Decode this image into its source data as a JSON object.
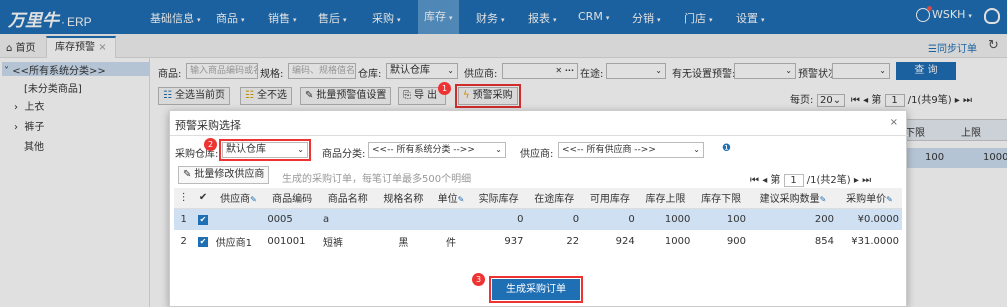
{
  "topbar": {
    "logo_text": "万里牛",
    "logo_dot": "·",
    "logo_erp": "ERP",
    "nav": [
      "基础信息",
      "商品",
      "销售",
      "售后",
      "采购",
      "库存",
      "财务",
      "报表",
      "CRM",
      "分销",
      "门店",
      "设置"
    ],
    "active_nav": "库存",
    "caret": "▾",
    "user": "WSKH",
    "user_caret": "▾",
    "accent": "#1f6fb5"
  },
  "tabs": {
    "home": "首页",
    "stock": "库存预警",
    "close": "×",
    "sync": "同步订单"
  },
  "sidebar": {
    "root": "<<所有系统分类>>",
    "items": [
      "[未分类商品]",
      "上衣",
      "裤子",
      "其他"
    ]
  },
  "filters": {
    "product_label": "商品:",
    "product_placeholder": "输入商品编码或名",
    "spec_label": "规格:",
    "spec_placeholder": "编码、规格值名称",
    "warehouse_label": "仓库:",
    "warehouse_value": "默认仓库",
    "supplier_label": "供应商:",
    "intransit_label": "在途:",
    "noupper_label": "有无设置预警:",
    "warnstatus_label": "预警状况:",
    "query": "查 询"
  },
  "toolbar": {
    "select_all": "全选当前页",
    "select_none": "全不选",
    "batch_warn": "批量预警值设置",
    "export": "导 出",
    "warn_purchase": "预警采购",
    "per_page_label": "每页:",
    "per_page": "20",
    "page_label": "第",
    "page": "1",
    "page_total": "/1(共9笔)"
  },
  "bg_grid": {
    "lower": "下限",
    "upper": "上限",
    "v1": "100",
    "v2": "1000"
  },
  "dialog": {
    "title": "预警采购选择",
    "close": "×",
    "warehouse_label": "采购仓库:",
    "warehouse_value": "默认仓库",
    "category_label": "商品分类:",
    "category_value": "<<-- 所有系统分类 -->>",
    "supplier_label": "供应商:",
    "supplier_value": "<<-- 所有供应商 -->>",
    "info": "❶",
    "batch_edit": "批量修改供应商",
    "hint": "生成的采购订单，每笔订单最多500个明细",
    "pager_page_label": "第",
    "pager_page": "1",
    "pager_total": "/1(共2笔)",
    "generate": "生成采购订单"
  },
  "grid": {
    "headers": [
      "",
      "✔",
      "供应商",
      "商品编码",
      "商品名称",
      "规格名称",
      "单位",
      "实际库存",
      "在途库存",
      "可用库存",
      "库存上限",
      "库存下限",
      "建议采购数量",
      "采购单价"
    ],
    "rows": [
      [
        "1",
        "✔",
        "",
        "0005",
        "a",
        "",
        "",
        "0",
        "0",
        "0",
        "1000",
        "100",
        "200",
        "¥0.0000"
      ],
      [
        "2",
        "✔",
        "供应商1",
        "001001",
        "短裤",
        "黑",
        "件",
        "937",
        "22",
        "924",
        "1000",
        "900",
        "854",
        "¥31.0000"
      ]
    ]
  },
  "badges": [
    "1",
    "2",
    "3"
  ]
}
